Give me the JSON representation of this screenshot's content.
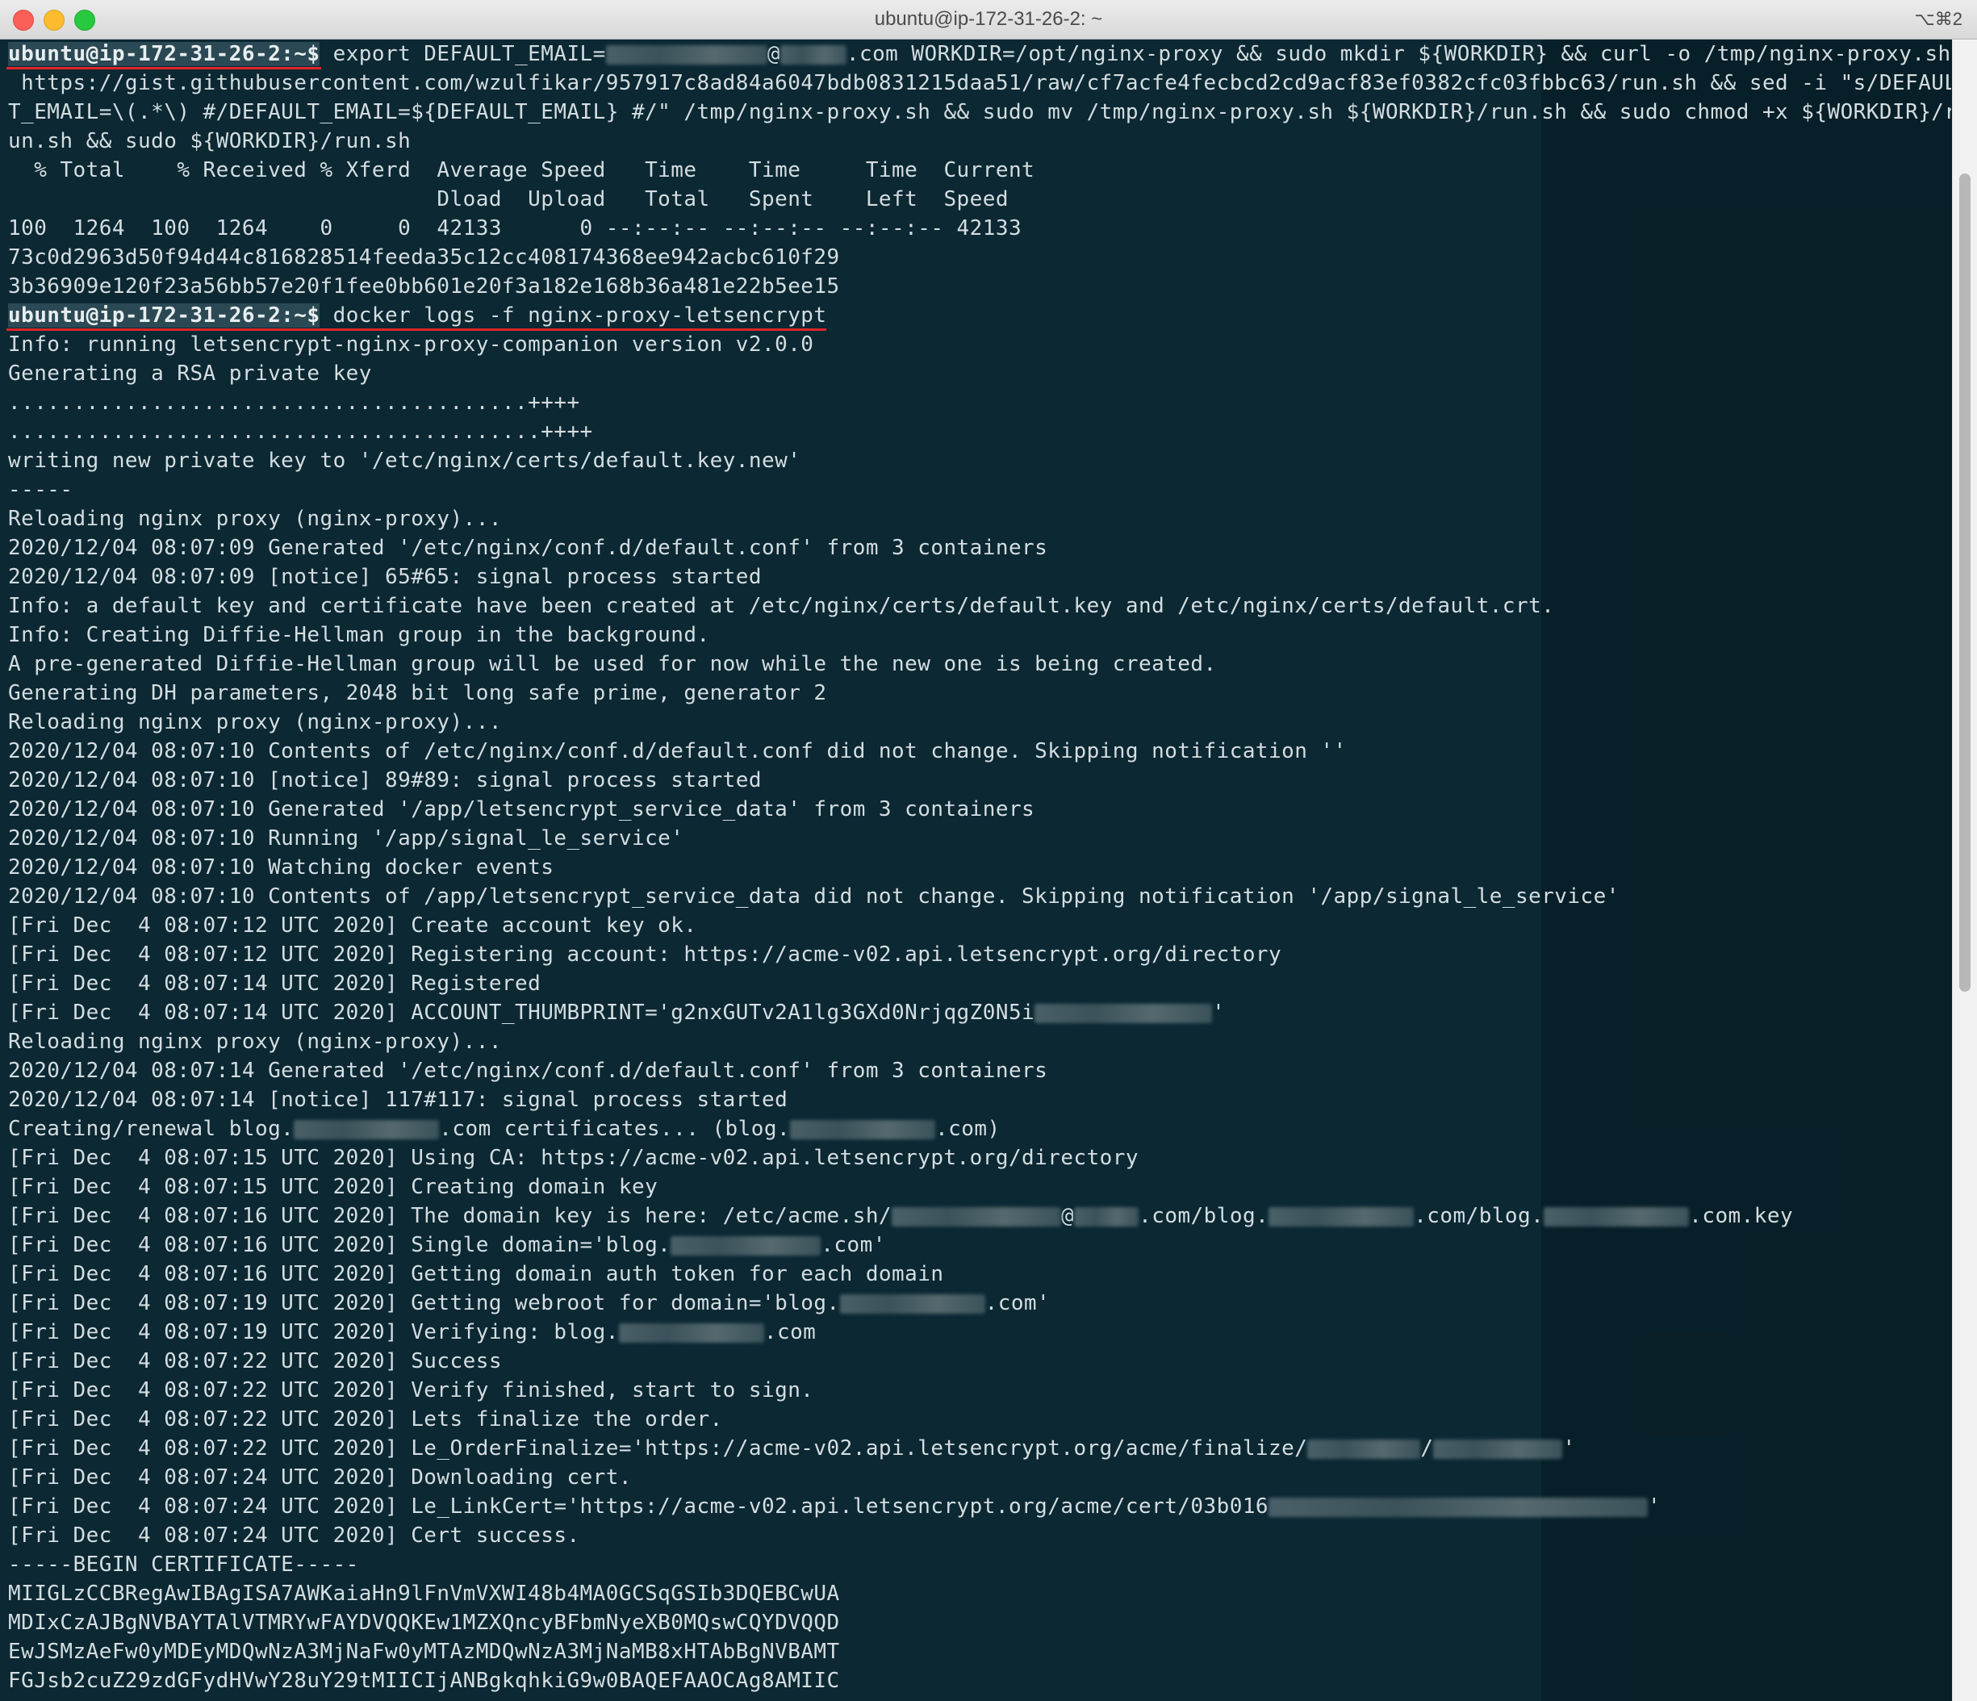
{
  "window": {
    "title": "ubuntu@ip-172-31-26-2: ~",
    "shortcut": "⌥⌘2"
  },
  "prompt": "ubuntu@ip-172-31-26-2:~$",
  "lines": {
    "l01_cmd_a": " export DEFAULT_EMAIL=",
    "l01_cmd_b": "@",
    "l01_cmd_c": ".com WORKDIR=/opt/nginx-proxy && sudo mkdir ${WORKDIR} && curl -o /tmp/nginx-proxy.sh",
    "l02": " https://gist.githubusercontent.com/wzulfikar/957917c8ad84a6047bdb0831215daa51/raw/cf7acfe4fecbcd2cd9acf83ef0382cfc03fbbc63/run.sh && sed -i \"s/DEFAUL",
    "l03": "T_EMAIL=\\(.*\\) #/DEFAULT_EMAIL=${DEFAULT_EMAIL} #/\" /tmp/nginx-proxy.sh && sudo mv /tmp/nginx-proxy.sh ${WORKDIR}/run.sh && sudo chmod +x ${WORKDIR}/r",
    "l04": "un.sh && sudo ${WORKDIR}/run.sh",
    "l05": "  % Total    % Received % Xferd  Average Speed   Time    Time     Time  Current",
    "l06": "                                 Dload  Upload   Total   Spent    Left  Speed",
    "l07": "100  1264  100  1264    0     0  42133      0 --:--:-- --:--:-- --:--:-- 42133",
    "l08": "73c0d2963d50f94d44c816828514feeda35c12cc408174368ee942acbc610f29",
    "l09": "3b36909e120f23a56bb57e20f1fee0bb601e20f3a182e168b36a481e22b5ee15",
    "l10_cmd": " docker logs -f nginx-proxy-letsencrypt",
    "l11": "Info: running letsencrypt-nginx-proxy-companion version v2.0.0",
    "l12": "Generating a RSA private key",
    "l13": "........................................++++",
    "l14": ".........................................++++",
    "l15": "writing new private key to '/etc/nginx/certs/default.key.new'",
    "l16": "-----",
    "l17": "Reloading nginx proxy (nginx-proxy)...",
    "l18": "2020/12/04 08:07:09 Generated '/etc/nginx/conf.d/default.conf' from 3 containers",
    "l19": "2020/12/04 08:07:09 [notice] 65#65: signal process started",
    "l20": "Info: a default key and certificate have been created at /etc/nginx/certs/default.key and /etc/nginx/certs/default.crt.",
    "l21": "Info: Creating Diffie-Hellman group in the background.",
    "l22": "A pre-generated Diffie-Hellman group will be used for now while the new one is being created.",
    "l23": "Generating DH parameters, 2048 bit long safe prime, generator 2",
    "l24": "Reloading nginx proxy (nginx-proxy)...",
    "l25": "2020/12/04 08:07:10 Contents of /etc/nginx/conf.d/default.conf did not change. Skipping notification ''",
    "l26": "2020/12/04 08:07:10 [notice] 89#89: signal process started",
    "l27": "2020/12/04 08:07:10 Generated '/app/letsencrypt_service_data' from 3 containers",
    "l28": "2020/12/04 08:07:10 Running '/app/signal_le_service'",
    "l29": "2020/12/04 08:07:10 Watching docker events",
    "l30": "2020/12/04 08:07:10 Contents of /app/letsencrypt_service_data did not change. Skipping notification '/app/signal_le_service'",
    "l31": "[Fri Dec  4 08:07:12 UTC 2020] Create account key ok.",
    "l32": "[Fri Dec  4 08:07:12 UTC 2020] Registering account: https://acme-v02.api.letsencrypt.org/directory",
    "l33": "[Fri Dec  4 08:07:14 UTC 2020] Registered",
    "l34_a": "[Fri Dec  4 08:07:14 UTC 2020] ACCOUNT_THUMBPRINT='g2nxGUTv2A1lg3GXd0NrjqgZ0N5i",
    "l34_b": "'",
    "l35": "Reloading nginx proxy (nginx-proxy)...",
    "l36": "2020/12/04 08:07:14 Generated '/etc/nginx/conf.d/default.conf' from 3 containers",
    "l37": "2020/12/04 08:07:14 [notice] 117#117: signal process started",
    "l38_a": "Creating/renewal blog.",
    "l38_b": ".com certificates... (blog.",
    "l38_c": ".com)",
    "l39": "[Fri Dec  4 08:07:15 UTC 2020] Using CA: https://acme-v02.api.letsencrypt.org/directory",
    "l40": "[Fri Dec  4 08:07:15 UTC 2020] Creating domain key",
    "l41_a": "[Fri Dec  4 08:07:16 UTC 2020] The domain key is here: /etc/acme.sh/",
    "l41_b": "@",
    "l41_c": ".com/blog.",
    "l41_d": ".com/blog.",
    "l41_e": ".com.key",
    "l42_a": "[Fri Dec  4 08:07:16 UTC 2020] Single domain='blog.",
    "l42_b": ".com'",
    "l43": "[Fri Dec  4 08:07:16 UTC 2020] Getting domain auth token for each domain",
    "l44_a": "[Fri Dec  4 08:07:19 UTC 2020] Getting webroot for domain='blog.",
    "l44_b": ".com'",
    "l45_a": "[Fri Dec  4 08:07:19 UTC 2020] Verifying: blog.",
    "l45_b": ".com",
    "l46": "[Fri Dec  4 08:07:22 UTC 2020] Success",
    "l47": "[Fri Dec  4 08:07:22 UTC 2020] Verify finished, start to sign.",
    "l48": "[Fri Dec  4 08:07:22 UTC 2020] Lets finalize the order.",
    "l49_a": "[Fri Dec  4 08:07:22 UTC 2020] Le_OrderFinalize='https://acme-v02.api.letsencrypt.org/acme/finalize/",
    "l49_b": "/",
    "l49_c": "'",
    "l50": "[Fri Dec  4 08:07:24 UTC 2020] Downloading cert.",
    "l51_a": "[Fri Dec  4 08:07:24 UTC 2020] Le_LinkCert='https://acme-v02.api.letsencrypt.org/acme/cert/03b016",
    "l51_b": "'",
    "l52": "[Fri Dec  4 08:07:24 UTC 2020] Cert success.",
    "l53": "-----BEGIN CERTIFICATE-----",
    "l54": "MIIGLzCCBRegAwIBAgISA7AWKaiaHn9lFnVmVXWI48b4MA0GCSqGSIb3DQEBCwUA",
    "l55": "MDIxCzAJBgNVBAYTAlVTMRYwFAYDVQQKEw1MZXQncyBFbmNyeXB0MQswCQYDVQQD",
    "l56": "EwJSMzAeFw0yMDEyMDQwNzA3MjNaFw0yMTAzMDQwNzA3MjNaMB8xHTAbBgNVBAMT",
    "l57": "FGJsb2cuZ29zdGFydHVwY28uY29tMIICIjANBgkqhkiG9w0BAQEFAAOCAg8AMIIC"
  }
}
